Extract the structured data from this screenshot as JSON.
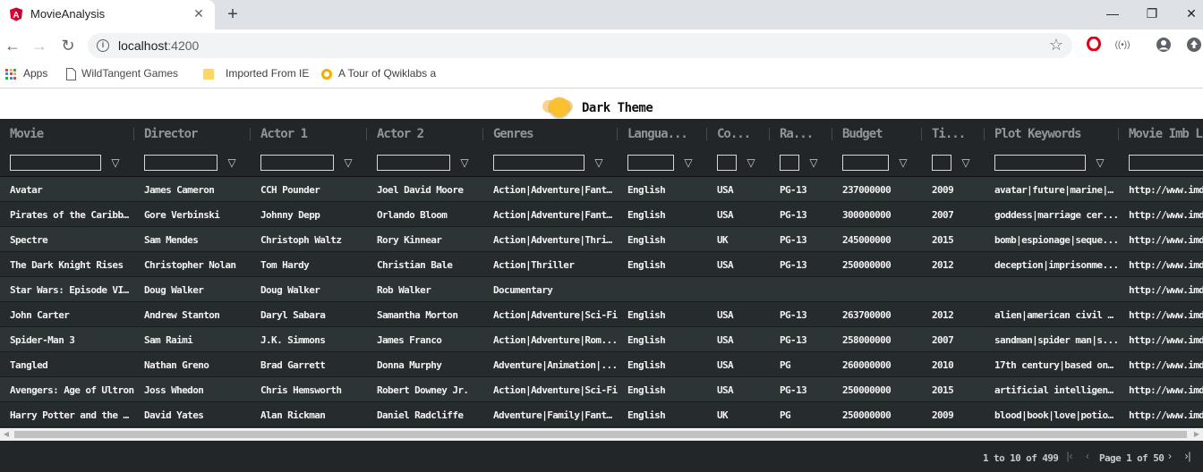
{
  "browser": {
    "tab_title": "MovieAnalysis",
    "url_host": "localhost",
    "url_port": ":4200",
    "bookmarks": [
      "Apps",
      "WildTangent Games",
      "Imported From IE",
      "A Tour of Qwiklabs a"
    ]
  },
  "app": {
    "theme_label": "Dark Theme",
    "theme_dark_enabled": true
  },
  "grid": {
    "columns": [
      "Movie",
      "Director",
      "Actor 1",
      "Actor 2",
      "Genres",
      "Langua...",
      "Co...",
      "Ra...",
      "Budget",
      "Ti...",
      "Plot Keywords",
      "Movie Imb Li"
    ],
    "rows": [
      [
        "Avatar",
        "James Cameron",
        "CCH Pounder",
        "Joel David Moore",
        "Action|Adventure|Fant...",
        "English",
        "USA",
        "PG-13",
        "237000000",
        "2009",
        "avatar|future|marine|...",
        "http://www.imd"
      ],
      [
        "Pirates of the Caribb...",
        "Gore Verbinski",
        "Johnny Depp",
        "Orlando Bloom",
        "Action|Adventure|Fant...",
        "English",
        "USA",
        "PG-13",
        "300000000",
        "2007",
        "goddess|marriage cer...",
        "http://www.imd"
      ],
      [
        "Spectre",
        "Sam Mendes",
        "Christoph Waltz",
        "Rory Kinnear",
        "Action|Adventure|Thril...",
        "English",
        "UK",
        "PG-13",
        "245000000",
        "2015",
        "bomb|espionage|seque...",
        "http://www.imd"
      ],
      [
        "The Dark Knight Rises",
        "Christopher Nolan",
        "Tom Hardy",
        "Christian Bale",
        "Action|Thriller",
        "English",
        "USA",
        "PG-13",
        "250000000",
        "2012",
        "deception|imprisonme...",
        "http://www.imd"
      ],
      [
        "Star Wars: Episode VI...",
        "Doug Walker",
        "Doug Walker",
        "Rob Walker",
        "Documentary",
        "",
        "",
        "",
        "",
        "",
        "",
        "http://www.imd"
      ],
      [
        "John Carter",
        "Andrew Stanton",
        "Daryl Sabara",
        "Samantha Morton",
        "Action|Adventure|Sci-Fi",
        "English",
        "USA",
        "PG-13",
        "263700000",
        "2012",
        "alien|american civil w...",
        "http://www.imd"
      ],
      [
        "Spider-Man 3",
        "Sam Raimi",
        "J.K. Simmons",
        "James Franco",
        "Action|Adventure|Rom...",
        "English",
        "USA",
        "PG-13",
        "258000000",
        "2007",
        "sandman|spider man|s...",
        "http://www.imd"
      ],
      [
        "Tangled",
        "Nathan Greno",
        "Brad Garrett",
        "Donna Murphy",
        "Adventure|Animation|...",
        "English",
        "USA",
        "PG",
        "260000000",
        "2010",
        "17th century|based on...",
        "http://www.imd"
      ],
      [
        "Avengers: Age of Ultron",
        "Joss Whedon",
        "Chris Hemsworth",
        "Robert Downey Jr.",
        "Action|Adventure|Sci-Fi",
        "English",
        "USA",
        "PG-13",
        "250000000",
        "2015",
        "artificial intelligence|...",
        "http://www.imd"
      ],
      [
        "Harry Potter and the ...",
        "David Yates",
        "Alan Rickman",
        "Daniel Radcliffe",
        "Adventure|Family|Fant...",
        "English",
        "UK",
        "PG",
        "250000000",
        "2009",
        "blood|book|love|potion...",
        "http://www.imd"
      ]
    ]
  },
  "pagination": {
    "summary": "1 to 10 of 499",
    "page_label": "Page 1 of 50"
  },
  "colors": {
    "accent": "#fbc02d",
    "grid_bg": "#2d3436",
    "header_bg": "#222628"
  }
}
